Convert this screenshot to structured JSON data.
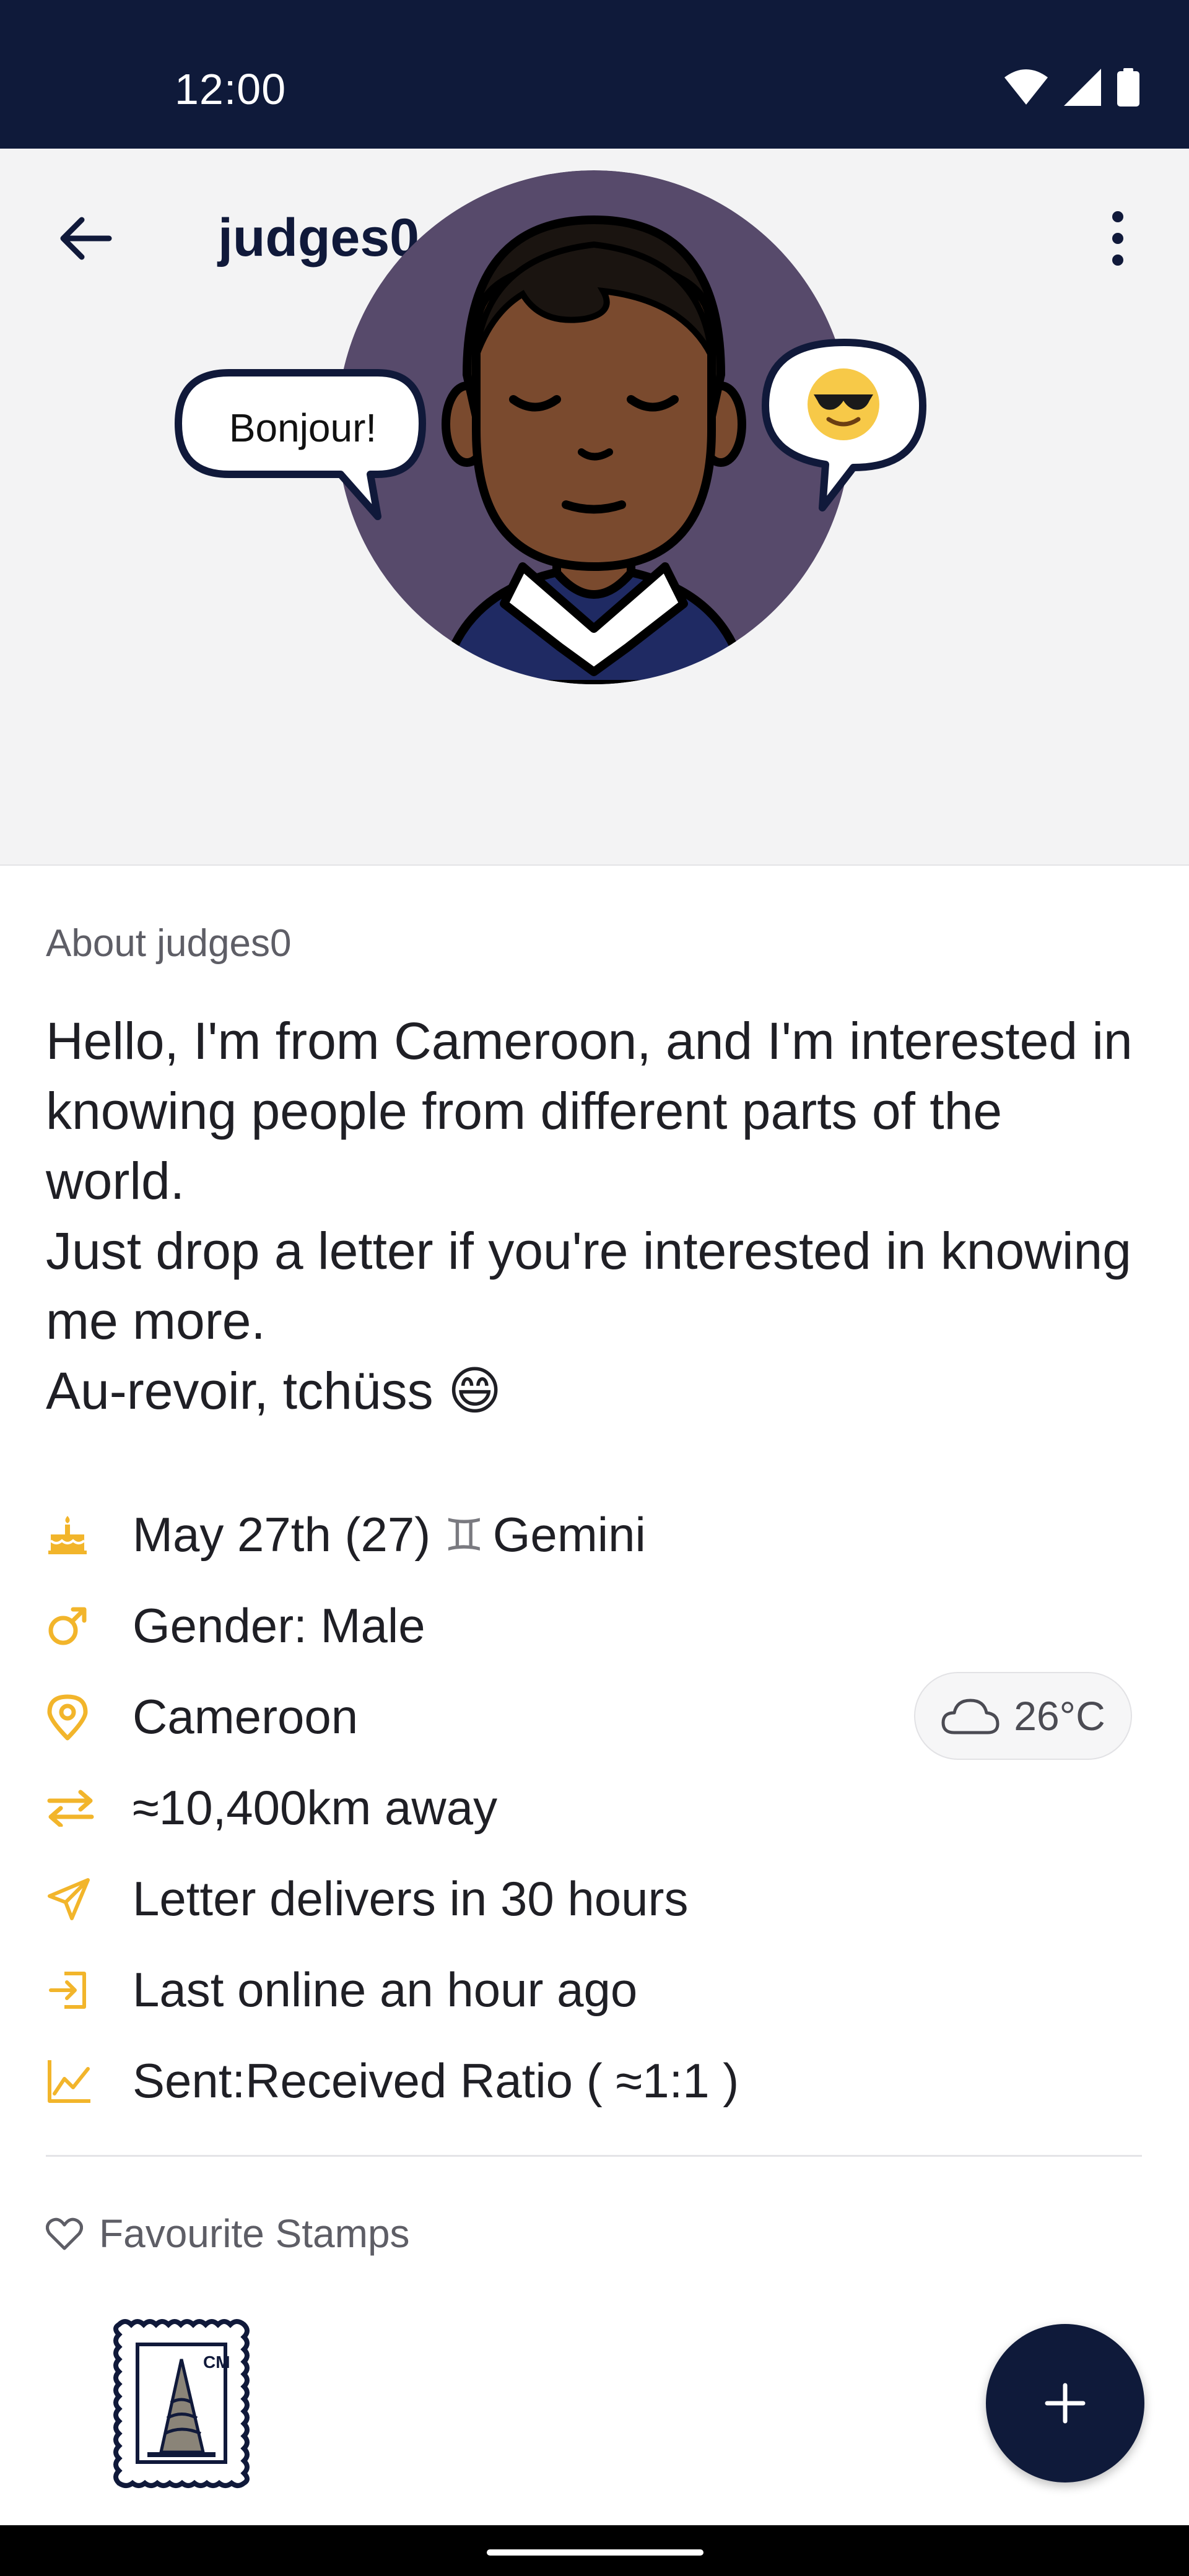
{
  "status_bar": {
    "time": "12:00"
  },
  "header": {
    "title": "judges0"
  },
  "avatar": {
    "bubble_left_text": "Bonjour!",
    "bubble_right_emoji": "😎"
  },
  "about": {
    "label": "About judges0",
    "text": "Hello, I'm from Cameroon, and I'm interested in knowing people from different parts of the world.\nJust drop a letter if you're interested in knowing me more.\nAu-revoir, tchüss 😄"
  },
  "info": {
    "birthday": "May 27th (27)",
    "zodiac_glyph": "♊",
    "zodiac": "Gemini",
    "gender": "Gender: Male",
    "location": "Cameroon",
    "distance": "≈10,400km away",
    "delivery": "Letter delivers in 30 hours",
    "last_online": "Last online an hour ago",
    "ratio": "Sent:Received Ratio ( ≈1:1 )"
  },
  "weather": {
    "temp": "26°C",
    "icon": "cloud-icon"
  },
  "favourites": {
    "label": "Favourite Stamps",
    "stamp_code": "CM"
  },
  "colors": {
    "navy": "#0f1a3a",
    "accent_yellow": "#f2b52b",
    "avatar_bg": "#574a6b",
    "skin": "#7a4a2e"
  }
}
